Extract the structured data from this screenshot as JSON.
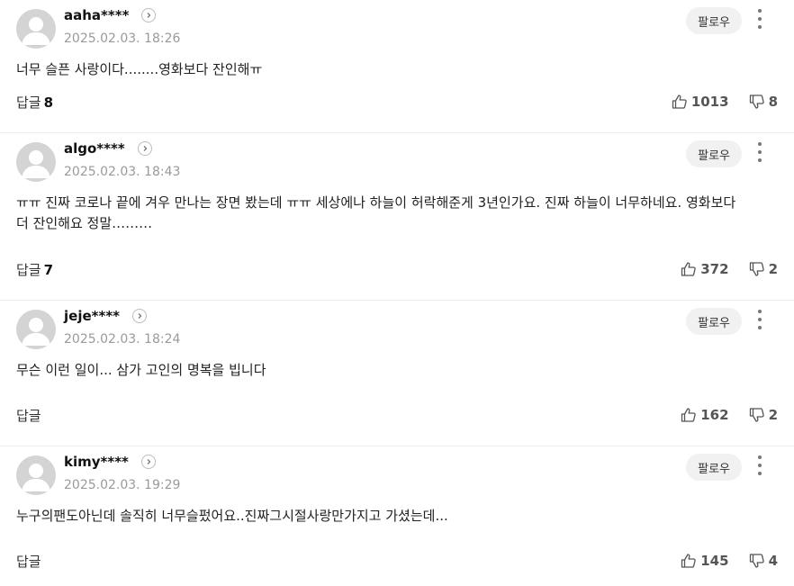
{
  "follow_label": "팔로우",
  "comments": [
    {
      "username": "aaha****",
      "date": "2025.02.03. 18:26",
      "text": "너무 슬픈 사랑이다........영화보다 잔인해ㅠ",
      "reply_label": "답글",
      "reply_count": "8",
      "likes": "1013",
      "dislikes": "8"
    },
    {
      "username": "algo****",
      "date": "2025.02.03. 18:43",
      "text": "ㅠㅠ 진짜 코로나 끝에 겨우 만나는 장면 봤는데 ㅠㅠ 세상에나 하늘이 허락해준게 3년인가요. 진짜 하늘이 너무하네요. 영화보다 더 잔인해요 정말………",
      "reply_label": "답글",
      "reply_count": "7",
      "likes": "372",
      "dislikes": "2"
    },
    {
      "username": "jeje****",
      "date": "2025.02.03. 18:24",
      "text": "무슨 이런 일이... 삼가 고인의 명복을 빕니다",
      "reply_label": "답글",
      "reply_count": "",
      "likes": "162",
      "dislikes": "2"
    },
    {
      "username": "kimy****",
      "date": "2025.02.03. 19:29",
      "text": "누구의팬도아닌데 솔직히 너무슬펐어요..진짜그시절사랑만가지고 가셨는데...",
      "reply_label": "답글",
      "reply_count": "",
      "likes": "145",
      "dislikes": "4"
    }
  ]
}
